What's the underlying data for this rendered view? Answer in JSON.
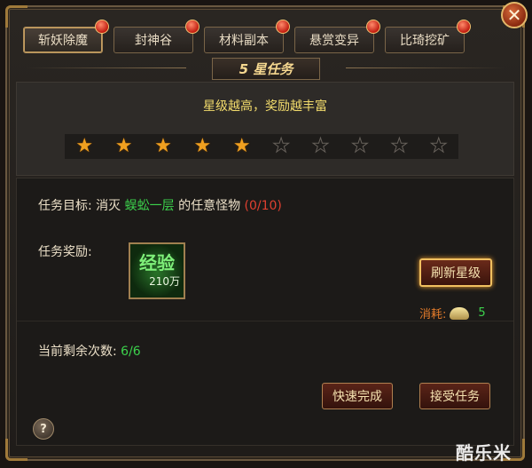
{
  "tabs": [
    {
      "label": "斩妖除魔",
      "active": true
    },
    {
      "label": "封神谷",
      "active": false
    },
    {
      "label": "材料副本",
      "active": false
    },
    {
      "label": "悬赏变异",
      "active": false
    },
    {
      "label": "比琦挖矿",
      "active": false
    }
  ],
  "title": "5  星任务",
  "slogan": "星级越高，奖励越丰富",
  "stars": {
    "filled": 5,
    "total": 10
  },
  "task": {
    "target_label": "任务目标:",
    "target_pre": "消灭",
    "monster": "蜈蚣一层",
    "target_post": "的任意怪物",
    "progress": "(0/10)"
  },
  "reward": {
    "label": "任务奖励:",
    "item_name": "经验",
    "item_amount": "210万"
  },
  "refresh": {
    "label": "刷新星级",
    "cost_label": "消耗:",
    "cost_value": "5"
  },
  "remaining": {
    "label": "当前剩余次数:",
    "value": "6/6"
  },
  "actions": {
    "quick_complete": "快速完成",
    "accept": "接受任务"
  },
  "help": "?",
  "close": "✕",
  "watermark": "酷乐米",
  "colors": {
    "accent_gold": "#f3dc6c",
    "green": "#3cd24c",
    "red": "#e04030"
  }
}
